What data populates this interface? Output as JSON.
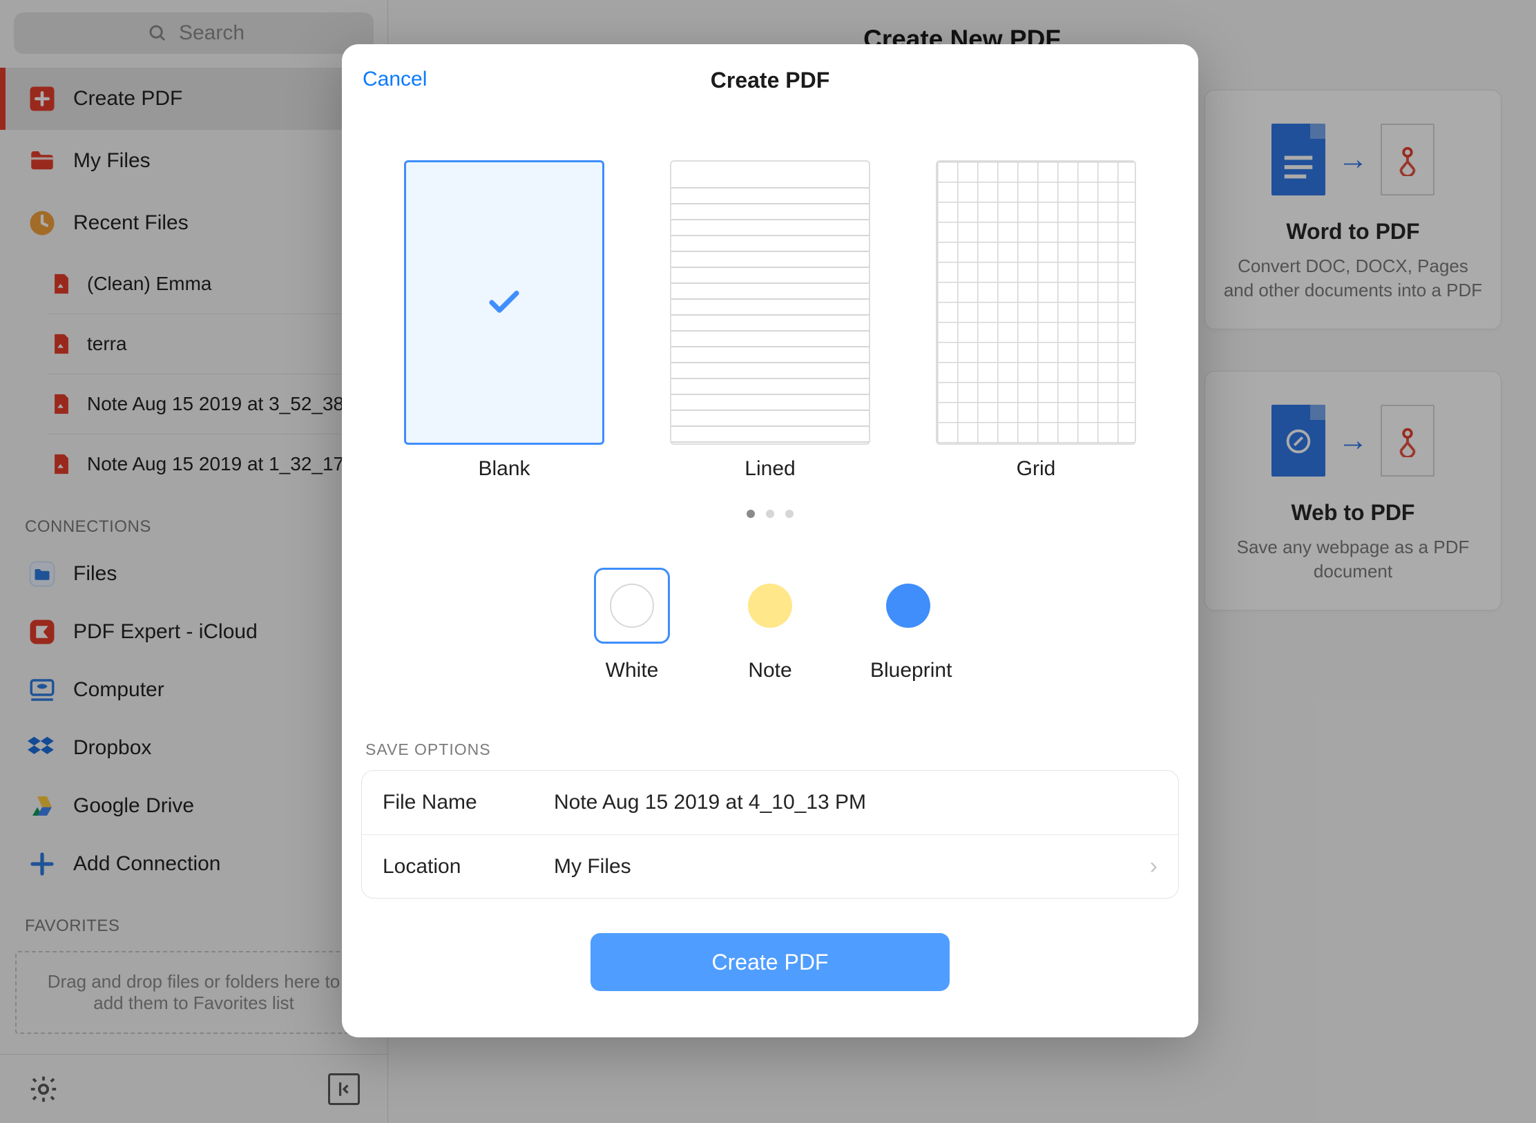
{
  "sidebar": {
    "search_placeholder": "Search",
    "nav": {
      "create_pdf": "Create PDF",
      "my_files": "My Files",
      "recent_files": "Recent Files"
    },
    "recent_items": [
      "(Clean) Emma",
      "terra",
      "Note Aug 15 2019 at 3_52_38",
      "Note Aug 15 2019 at 1_32_17"
    ],
    "connections_label": "CONNECTIONS",
    "connections": [
      "Files",
      "PDF Expert - iCloud",
      "Computer",
      "Dropbox",
      "Google Drive",
      "Add Connection"
    ],
    "favorites_label": "FAVORITES",
    "favorites_drop": "Drag and drop files or folders here to add them to Favorites list"
  },
  "main": {
    "title": "Create New PDF",
    "cards": {
      "word": {
        "title": "Word to PDF",
        "desc": "Convert DOC, DOCX, Pages and other documents into a PDF"
      },
      "web": {
        "title": "Web to PDF",
        "desc": "Save any webpage as a PDF document"
      }
    }
  },
  "modal": {
    "cancel": "Cancel",
    "title": "Create PDF",
    "templates": {
      "blank": "Blank",
      "lined": "Lined",
      "grid": "Grid"
    },
    "swatches": {
      "white": {
        "label": "White",
        "color": "#ffffff",
        "border": "#d8d8d8"
      },
      "note": {
        "label": "Note",
        "color": "#ffe78a"
      },
      "blueprint": {
        "label": "Blueprint",
        "color": "#3f8efc"
      }
    },
    "save_section_label": "SAVE OPTIONS",
    "filename": {
      "key": "File Name",
      "value": "Note Aug 15 2019 at 4_10_13 PM"
    },
    "location": {
      "key": "Location",
      "value": "My Files"
    },
    "create_btn": "Create PDF"
  },
  "colors": {
    "accent": "#0a7aff",
    "red": "#e63e2c",
    "orange": "#f2a03d"
  }
}
